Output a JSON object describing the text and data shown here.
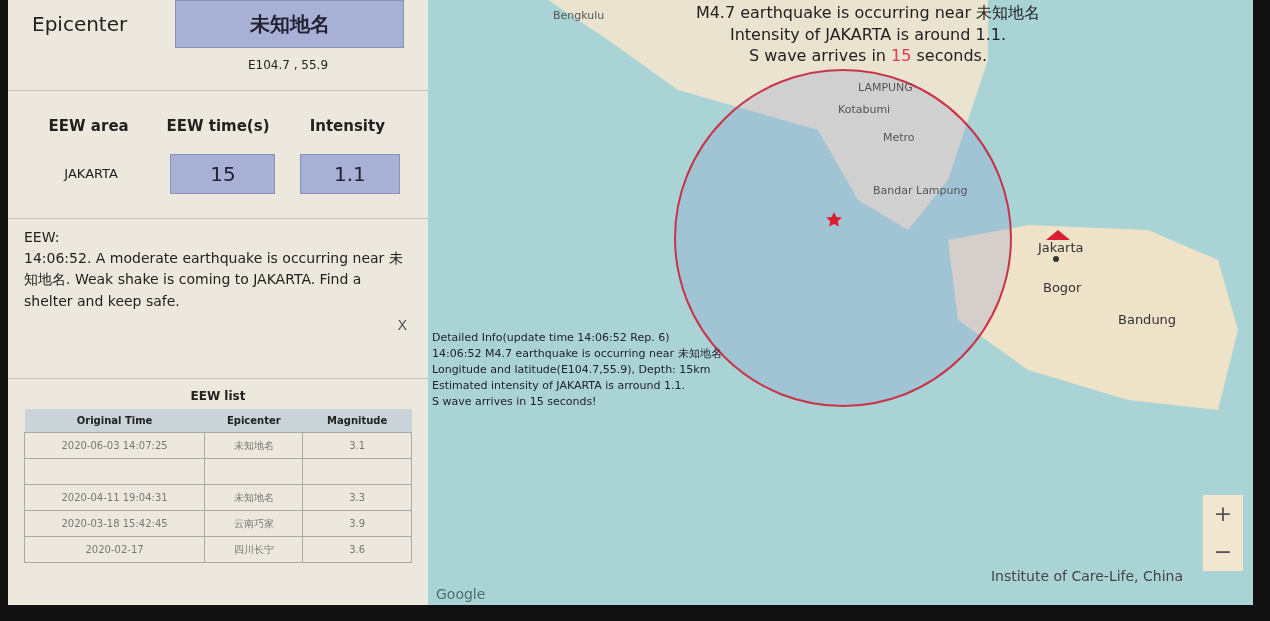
{
  "epicenter": {
    "label": "Epicenter",
    "name": "未知地名",
    "coords": "E104.7 , 55.9"
  },
  "eew": {
    "columns": [
      "EEW area",
      "EEW time(s)",
      "Intensity"
    ],
    "area": "JAKARTA",
    "time": "15",
    "intensity": "1.1"
  },
  "message": {
    "heading": "EEW:",
    "text": "14:06:52. A moderate earthquake is occurring near 未知地名. Weak shake is coming to JAKARTA. Find a shelter and keep safe.",
    "close": "X"
  },
  "eew_list": {
    "title": "EEW list",
    "columns": [
      "Original Time",
      "Epicenter",
      "Magnitude"
    ],
    "rows": [
      [
        "2020-06-03 14:07:25",
        "未知地名",
        "3.1"
      ],
      [
        "",
        "",
        ""
      ],
      [
        "2020-04-11 19:04:31",
        "未知地名",
        "3.3"
      ],
      [
        "2020-03-18 15:42:45",
        "云南巧家",
        "3.9"
      ],
      [
        "2020-02-17",
        "四川长宁",
        "3.6"
      ]
    ]
  },
  "map": {
    "alert": {
      "line1": "M4.7 earthquake is occurring near 未知地名",
      "line2": "Intensity of JAKARTA is around 1.1.",
      "before": "S wave arrives in ",
      "count": "15",
      "after": " seconds."
    },
    "places": [
      "Bengkulu",
      "LAMPUNG",
      "Kotabumi",
      "Metro",
      "Bandar Lampung",
      "Jakarta",
      "Bogor",
      "Bandung"
    ],
    "detail": [
      "Detailed Info(update time 14:06:52 Rep. 6)",
      "14:06:52 M4.7 earthquake is occurring near 未知地名",
      "Longitude and latitude(E104.7,55.9), Depth: 15km",
      "Estimated intensity of JAKARTA is arround 1.1.",
      "S wave arrives in 15 seconds!"
    ],
    "zoom": [
      "+",
      "−"
    ],
    "logo": "Google",
    "attribution": "Institute of Care-Life, China"
  }
}
